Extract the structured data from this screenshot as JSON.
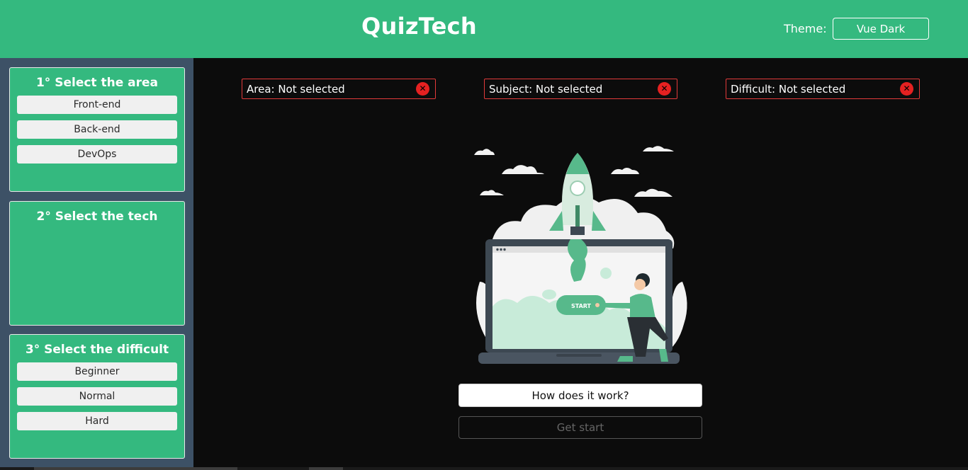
{
  "header": {
    "title": "QuizTech",
    "theme_label": "Theme:",
    "theme_value": "Vue Dark"
  },
  "sidebar": {
    "area": {
      "title": "1° Select the area",
      "options": [
        "Front-end",
        "Back-end",
        "DevOps"
      ]
    },
    "tech": {
      "title": "2° Select the tech",
      "options": []
    },
    "difficult": {
      "title": "3° Select the difficult",
      "options": [
        "Beginner",
        "Normal",
        "Hard"
      ]
    }
  },
  "status": {
    "area": "Area: Not selected",
    "subject": "Subject: Not selected",
    "difficult": "Difficult: Not selected",
    "clear_glyph": "✕"
  },
  "illustration": {
    "button_text": "START"
  },
  "actions": {
    "how_label": "How does it work?",
    "start_label": "Get start"
  },
  "colors": {
    "brand": "#34b97f",
    "sidebar": "#3d5166",
    "background": "#0c0c0c",
    "error": "#e23a3a"
  },
  "icons": {
    "clear": "close-circle-icon"
  }
}
